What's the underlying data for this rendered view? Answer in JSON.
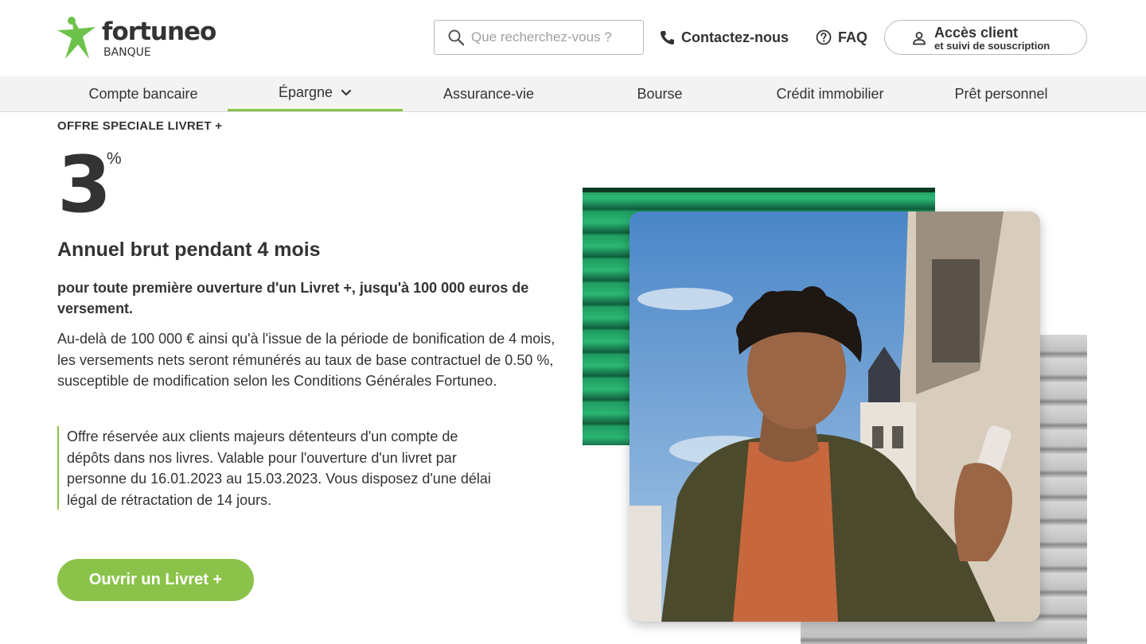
{
  "brand": {
    "name": "fortuneo",
    "subtitle": "BANQUE",
    "accent_color": "#8bc34a",
    "star_color": "#6cc24a"
  },
  "header": {
    "search_placeholder": "Que recherchez-vous ?",
    "search_icon": "search-icon",
    "contact_label": "Contactez-nous",
    "contact_icon": "phone-icon",
    "faq_label": "FAQ",
    "faq_icon": "question-circle-icon",
    "client_button": {
      "line1": "Accès client",
      "line2": "et suivi de souscription",
      "icon": "user-icon"
    }
  },
  "nav": {
    "items": [
      {
        "label": "Compte bancaire"
      },
      {
        "label": "Épargne",
        "active": true,
        "icon": "chevron-down-icon"
      },
      {
        "label": "Assurance-vie"
      },
      {
        "label": "Bourse"
      },
      {
        "label": "Crédit immobilier"
      },
      {
        "label": "Prêt personnel"
      }
    ]
  },
  "offer": {
    "kicker": "OFFRE SPECIALE LIVRET +",
    "rate": "3",
    "rate_unit": "%",
    "subtitle": "Annuel brut pendant 4 mois",
    "lead": "pour toute première ouverture d'un Livret +, jusqu'à 100 000 euros de versement.",
    "body": "Au-delà de 100 000 € ainsi qu'à l'issue de la période de bonification de 4 mois, les versements nets seront rémunérés au taux de base contractuel de 0.50 %, susceptible de modification selon les Conditions Générales Fortuneo.",
    "notice_lines": [
      "Offre réservée aux clients majeurs détenteurs d'un compte de",
      "dépôts dans nos livres. Valable pour l'ouverture d'un livret par",
      "personne du 16.01.2023 au 15.03.2023. Vous disposez d'une délai",
      "légal de rétractation de 14 jours."
    ],
    "cta_label": "Ouvrir un Livret +"
  }
}
